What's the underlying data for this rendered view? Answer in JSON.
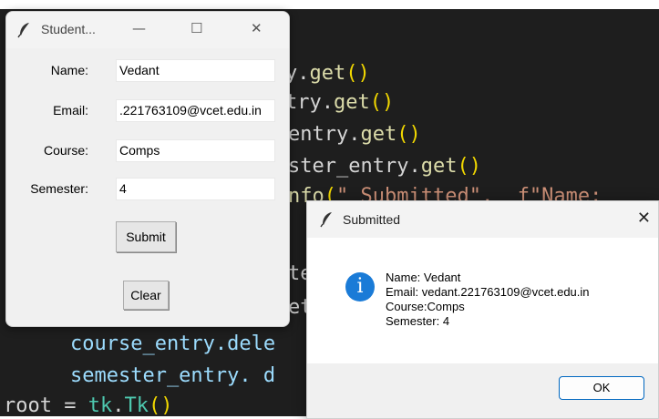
{
  "editor": {
    "lines": [
      {
        "plain": "y.",
        "func": "get",
        "paren": "()"
      },
      {
        "plain": "try.",
        "func": "get",
        "paren": "()"
      },
      {
        "plain": "entry.",
        "func": "get",
        "paren": "()"
      },
      {
        "plain": "ster_entry.",
        "func": "get",
        "paren": "()"
      },
      {
        "plain": "nfo",
        "paren": "(",
        "str": "\"_Submitted\"",
        "tail": ",  f\"Name:"
      },
      {
        "plain": "te"
      },
      {
        "plain": "et"
      },
      {
        "plain": "    course_entry.dele"
      },
      {
        "plain": "    semester_entry. d"
      },
      {
        "plain": "root = ",
        "teal": "tk",
        "dot": ".",
        "teal2": "Tk",
        "paren": "()"
      }
    ]
  },
  "main_window": {
    "title": "Student...",
    "minimize": "—",
    "maximize": "☐",
    "close": "✕",
    "name_label": "Name:",
    "name_value": "Vedant",
    "email_label": "Email:",
    "email_value": ".221763109@vcet.edu.in",
    "course_label": "Course:",
    "course_value": "Comps",
    "semester_label": "Semester:",
    "semester_value": "4",
    "submit_label": "Submit",
    "clear_label": "Clear"
  },
  "message_box": {
    "title": "Submitted",
    "close": "✕",
    "icon_glyph": "i",
    "lines": [
      "Name: Vedant",
      "Email: vedant.221763109@vcet.edu.in",
      "Course:Comps",
      "Semester: 4"
    ],
    "ok_label": "OK"
  },
  "colors": {
    "editor_bg": "#1e1e1e",
    "info_blue": "#1a7bd7",
    "ok_border": "#0067c0"
  }
}
